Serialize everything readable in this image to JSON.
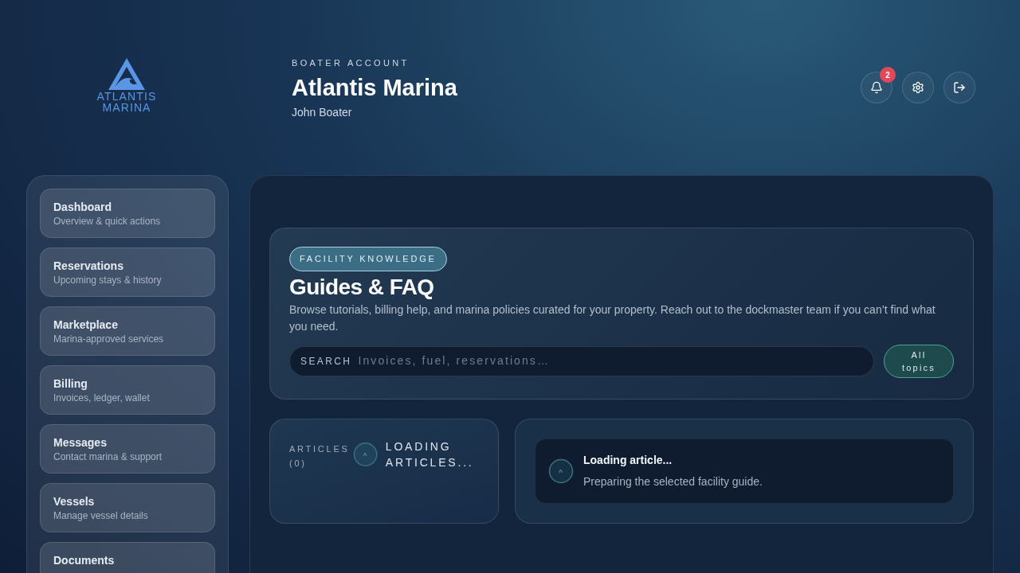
{
  "logo": {
    "lines": [
      "ATLANTIS",
      "MARINA"
    ]
  },
  "header": {
    "eyebrow": "BOATER ACCOUNT",
    "title": "Atlantis Marina",
    "user": "John Boater"
  },
  "actions": [
    {
      "kind": "notifications",
      "badge": "2"
    },
    {
      "kind": "settings"
    },
    {
      "kind": "logout"
    }
  ],
  "sidebar": {
    "items": [
      {
        "label": "Dashboard",
        "sub": "Overview & quick actions"
      },
      {
        "label": "Reservations",
        "sub": "Upcoming stays & history"
      },
      {
        "label": "Marketplace",
        "sub": "Marina-approved services"
      },
      {
        "label": "Billing",
        "sub": "Invoices, ledger, wallet"
      },
      {
        "label": "Messages",
        "sub": "Contact marina & support"
      },
      {
        "label": "Vessels",
        "sub": "Manage vessel details"
      },
      {
        "label": "Documents"
      }
    ]
  },
  "guides": {
    "tag": "FACILITY KNOWLEDGE",
    "title": "Guides & FAQ",
    "description": "Browse tutorials, billing help, and marina policies curated for your property. Reach out to the dockmaster team if you can’t find what you need.",
    "search_label": "SEARCH",
    "search_placeholder": "Invoices, fuel, reservations…",
    "filter_button": "All topics"
  },
  "articles": {
    "label": "ARTICLES",
    "count": "(0)",
    "status": "LOADING ARTICLES..."
  },
  "article": {
    "title": "Loading article...",
    "text": "Preparing the selected facility guide."
  }
}
